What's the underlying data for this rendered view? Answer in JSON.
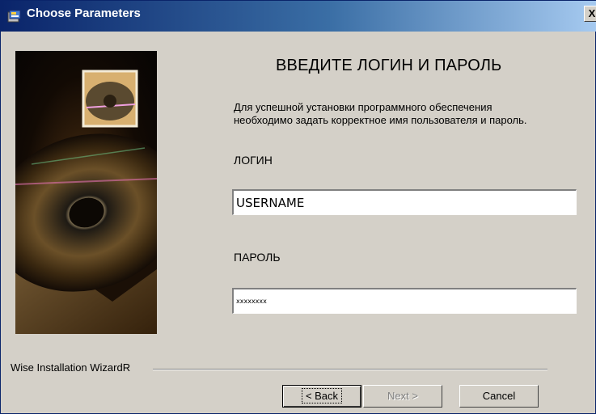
{
  "window": {
    "title": "Choose Parameters",
    "close_glyph": "X",
    "icon": "installer-app-icon"
  },
  "main": {
    "heading": "ВВЕДИТЕ ЛОГИН И ПАРОЛЬ",
    "description": "Для успешной установки программного обеспечения необходимо задать корректное имя пользователя и пароль.",
    "login_label": "ЛОГИН",
    "login_value": "USERNAME",
    "password_label": "ПАРОЛЬ",
    "password_value": "xxxxxxxx"
  },
  "footer": {
    "brand": "Wise Installation WizardR",
    "back_label": "< Back",
    "next_label": "Next >",
    "cancel_label": "Cancel"
  },
  "colors": {
    "titlebar_start": "#0a246a",
    "titlebar_end": "#a6caf0",
    "face": "#d4d0c8"
  }
}
